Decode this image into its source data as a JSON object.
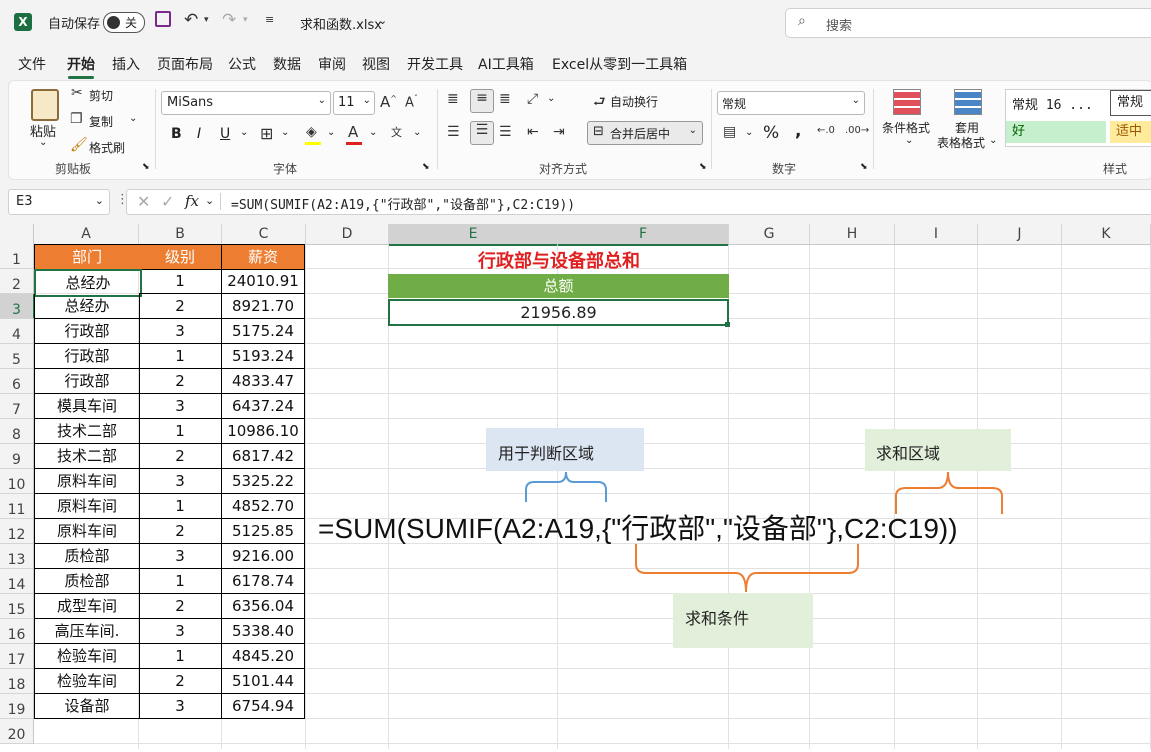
{
  "titlebar": {
    "autosave_label": "自动保存",
    "autosave_state": "关",
    "filename": "求和函数.xlsx",
    "search_placeholder": "搜索"
  },
  "menu": [
    "文件",
    "开始",
    "插入",
    "页面布局",
    "公式",
    "数据",
    "审阅",
    "视图",
    "开发工具",
    "AI工具箱",
    "Excel从零到一工具箱"
  ],
  "ribbon": {
    "clipboard": {
      "paste": "粘贴",
      "cut": "剪切",
      "copy": "复制",
      "format_painter": "格式刷",
      "label": "剪贴板"
    },
    "font": {
      "name": "MiSans",
      "size": "11",
      "label": "字体",
      "bold": "B",
      "italic": "I",
      "underline": "U"
    },
    "alignment": {
      "wrap": "自动换行",
      "merge": "合并后居中",
      "label": "对齐方式"
    },
    "number": {
      "format": "常规",
      "percent": "%",
      "comma": ",",
      "label": "数字"
    },
    "styles": {
      "conditional": "条件格式",
      "table_format_1": "套用",
      "table_format_2": "表格格式",
      "style_normal": "常规 16 ...",
      "style_normal2": "常规",
      "style_good": "好",
      "style_neutral": "适中",
      "label": "样式"
    }
  },
  "formula_bar": {
    "name_box": "E3",
    "fx": "fx",
    "formula": "=SUM(SUMIF(A2:A19,{\"行政部\",\"设备部\"},C2:C19))"
  },
  "columns": [
    "A",
    "B",
    "C",
    "D",
    "E",
    "F",
    "G",
    "H",
    "I",
    "J",
    "K"
  ],
  "rows": [
    "1",
    "2",
    "3",
    "4",
    "5",
    "6",
    "7",
    "8",
    "9",
    "10",
    "11",
    "12",
    "13",
    "14",
    "15",
    "16",
    "17",
    "18",
    "19",
    "20"
  ],
  "table": {
    "headers": [
      "部门",
      "级别",
      "薪资"
    ],
    "rows": [
      [
        "总经办",
        "1",
        "24010.91"
      ],
      [
        "总经办",
        "2",
        "8921.70"
      ],
      [
        "行政部",
        "3",
        "5175.24"
      ],
      [
        "行政部",
        "1",
        "5193.24"
      ],
      [
        "行政部",
        "2",
        "4833.47"
      ],
      [
        "模具车间",
        "3",
        "6437.24"
      ],
      [
        "技术二部",
        "1",
        "10986.10"
      ],
      [
        "技术二部",
        "2",
        "6817.42"
      ],
      [
        "原料车间",
        "3",
        "5325.22"
      ],
      [
        "原料车间",
        "1",
        "4852.70"
      ],
      [
        "原料车间",
        "2",
        "5125.85"
      ],
      [
        "质检部",
        "3",
        "9216.00"
      ],
      [
        "质检部",
        "1",
        "6178.74"
      ],
      [
        "成型车间",
        "2",
        "6356.04"
      ],
      [
        "高压车间.",
        "3",
        "5338.40"
      ],
      [
        "检验车间",
        "1",
        "4845.20"
      ],
      [
        "检验车间",
        "2",
        "5101.44"
      ],
      [
        "设备部",
        "3",
        "6754.94"
      ]
    ]
  },
  "summary": {
    "title": "行政部与设备部总和",
    "header": "总额",
    "value": "21956.89"
  },
  "annotation": {
    "formula": "=SUM(SUMIF(A2:A19,{\"行政部\",\"设备部\"},C2:C19))",
    "judge_range": "用于判断区域",
    "sum_range": "求和区域",
    "sum_condition": "求和条件"
  },
  "colors": {
    "accent": "#217346",
    "header_orange": "#ed7d31",
    "summary_green": "#70ad47",
    "title_red": "#e02020"
  }
}
